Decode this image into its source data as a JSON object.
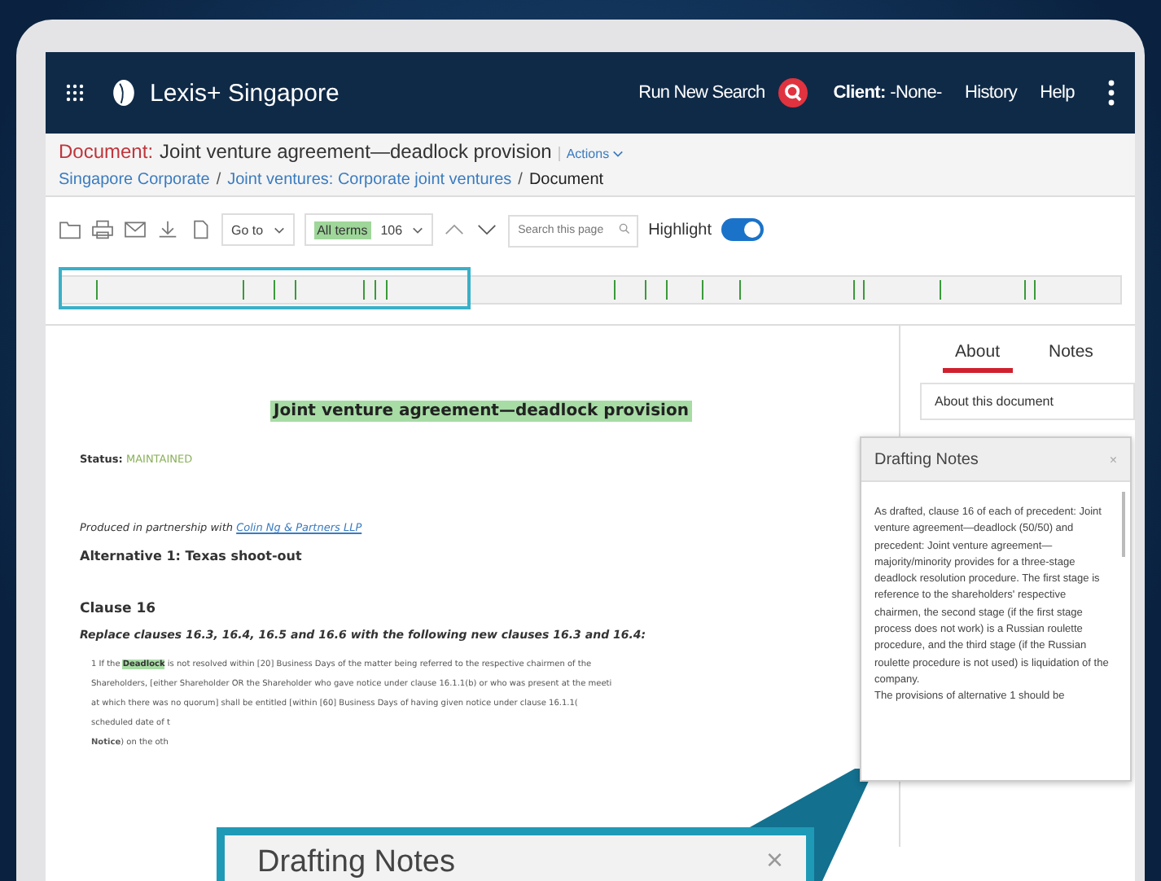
{
  "navbar": {
    "brand": "Lexis+ Singapore",
    "run_search": "Run New Search",
    "client_label": "Client:",
    "client_value": "-None-",
    "links": [
      "History",
      "Help"
    ]
  },
  "document_header": {
    "label": "Document:",
    "title": "Joint venture agreement—deadlock provision",
    "actions": "Actions",
    "breadcrumbs": [
      {
        "text": "Singapore Corporate",
        "kind": "link"
      },
      {
        "text": "/",
        "kind": "separator"
      },
      {
        "text": "Joint ventures: Corporate joint ventures",
        "kind": "link"
      },
      {
        "text": "/",
        "kind": "separator"
      },
      {
        "text": "Document",
        "kind": "current"
      }
    ]
  },
  "toolbar": {
    "goto": "Go to",
    "terms_label": "All terms",
    "terms_count": "106",
    "search_placeholder": "Search this page",
    "highlight_label": "Highlight",
    "highlight_on": true
  },
  "document": {
    "title": "Joint venture agreement—deadlock provision",
    "status_label": "Status:",
    "status_value": "MAINTAINED",
    "produced_by": "Produced in partnership with",
    "partner_link": "Colin Ng & Partners LLP",
    "alternative": "Alternative 1: Texas shoot-out",
    "clause": "Clause 16",
    "instruction": "Replace clauses 16.3, 16.4, 16.5 and 16.6 with the following new clauses 16.3 and 16.4:",
    "lines": [
      [
        {
          "text": "1 If the ",
          "kind": "plain"
        },
        {
          "text": "Deadlock",
          "kind": "term"
        },
        {
          "text": " is not resolved within [20] Business Days of the matter being referred to the respective chairmen of the",
          "kind": "plain"
        }
      ],
      [
        {
          "text": "Shareholders, [either Shareholder OR the Shareholder who gave notice under clause 16.1.1(b) or who was present at the meeti",
          "kind": "plain"
        }
      ],
      [
        {
          "text": "at which there was no quorum] shall be entitled [within [60] Business Days of having given notice under clause 16.1.1(",
          "kind": "plain"
        }
      ],
      [
        {
          "text": "scheduled date of t",
          "kind": "plain"
        }
      ],
      [
        {
          "text": "Notice",
          "kind": "bold"
        },
        {
          "text": ") on the oth",
          "kind": "plain"
        }
      ]
    ]
  },
  "side_panel": {
    "tabs": [
      {
        "label": "About",
        "selected": true
      },
      {
        "label": "Notes",
        "selected": false
      }
    ],
    "about_item": "About this document"
  },
  "drafting_notes": {
    "title": "Drafting Notes",
    "close": "×",
    "paragraphs": [
      "As drafted, clause 16 of each of precedent: Joint venture agreement—deadlock (50/50) and precedent: Joint venture agreement—majority/minority provides for a three-stage deadlock resolution procedure. The first stage is reference to the shareholders' respective chairmen, the second stage (if the first stage process does not work) is a Russian roulette procedure, and the third stage (if the Russian roulette procedure is not used) is liquidation of the company.",
      "The provisions of alternative 1 should be"
    ]
  },
  "callout": {
    "title": "Drafting Notes",
    "close": "×"
  }
}
